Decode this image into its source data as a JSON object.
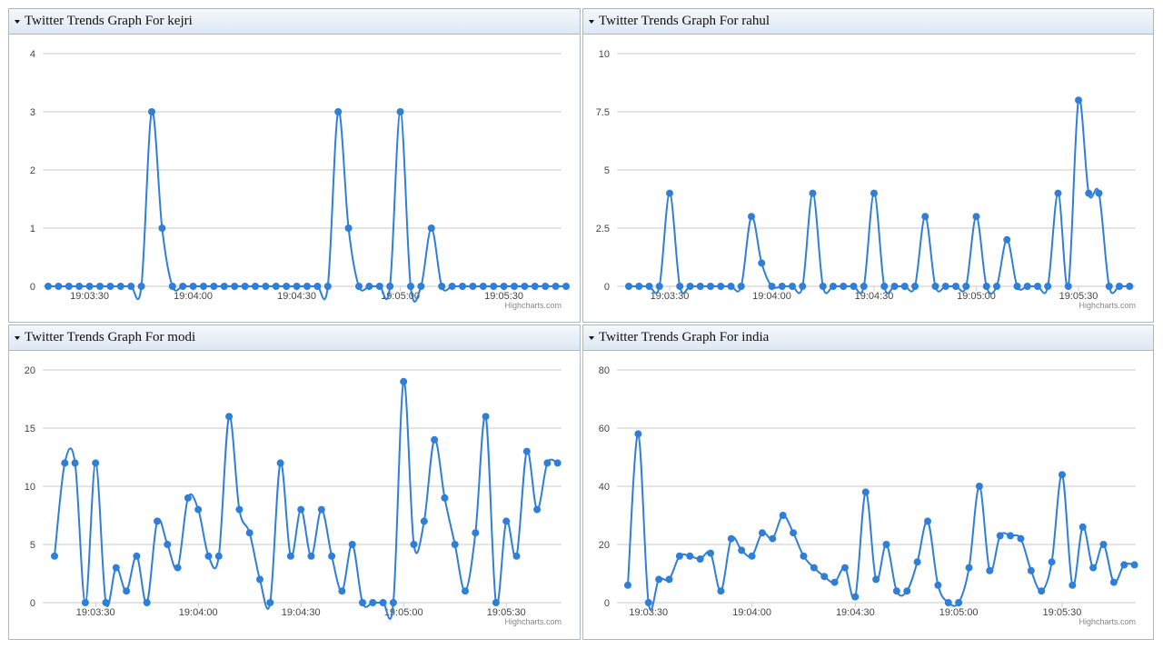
{
  "panels": [
    {
      "title": "Twitter Trends Graph For kejri"
    },
    {
      "title": "Twitter Trends Graph For rahul"
    },
    {
      "title": "Twitter Trends Graph For modi"
    },
    {
      "title": "Twitter Trends Graph For india"
    }
  ],
  "credit": "Highcharts.com",
  "accent_color": "#2f7ed8",
  "chart_data": [
    {
      "type": "line",
      "title": "Twitter Trends Graph For kejri",
      "x_tick_labels": [
        "19:03:30",
        "19:04:00",
        "19:04:30",
        "19:05:00",
        "19:05:30"
      ],
      "y_ticks": [
        "0",
        "1",
        "2",
        "3",
        "4"
      ],
      "ylim": [
        0,
        4
      ],
      "grid": true,
      "series": [
        {
          "values": [
            0,
            0,
            0,
            0,
            0,
            0,
            0,
            0,
            0,
            0,
            3,
            1,
            0,
            0,
            0,
            0,
            0,
            0,
            0,
            0,
            0,
            0,
            0,
            0,
            0,
            0,
            0,
            0,
            3,
            1,
            0,
            0,
            0,
            0,
            3,
            0,
            0,
            1,
            0,
            0,
            0,
            0,
            0,
            0,
            0,
            0,
            0,
            0,
            0,
            0,
            0
          ]
        }
      ]
    },
    {
      "type": "line",
      "title": "Twitter Trends Graph For rahul",
      "x_tick_labels": [
        "19:03:30",
        "19:04:00",
        "19:04:30",
        "19:05:00",
        "19:05:30"
      ],
      "y_ticks": [
        "0",
        "2.5",
        "5",
        "7.5",
        "10"
      ],
      "ylim": [
        0,
        10
      ],
      "grid": true,
      "series": [
        {
          "values": [
            0,
            0,
            0,
            0,
            4,
            0,
            0,
            0,
            0,
            0,
            0,
            0,
            3,
            1,
            0,
            0,
            0,
            0,
            4,
            0,
            0,
            0,
            0,
            0,
            4,
            0,
            0,
            0,
            0,
            3,
            0,
            0,
            0,
            0,
            3,
            0,
            0,
            2,
            0,
            0,
            0,
            0,
            4,
            0,
            8,
            4,
            4,
            0,
            0,
            0
          ]
        }
      ]
    },
    {
      "type": "line",
      "title": "Twitter Trends Graph For modi",
      "x_tick_labels": [
        "19:03:30",
        "19:04:00",
        "19:04:30",
        "19:05:00",
        "19:05:30"
      ],
      "y_ticks": [
        "0",
        "5",
        "10",
        "15",
        "20"
      ],
      "ylim": [
        0,
        20
      ],
      "grid": true,
      "series": [
        {
          "values": [
            4,
            12,
            12,
            0,
            12,
            0,
            3,
            1,
            4,
            0,
            7,
            5,
            3,
            9,
            8,
            4,
            4,
            16,
            8,
            6,
            2,
            0,
            12,
            4,
            8,
            4,
            8,
            4,
            1,
            5,
            0,
            0,
            0,
            0,
            19,
            5,
            7,
            14,
            9,
            5,
            1,
            6,
            16,
            0,
            7,
            4,
            13,
            8,
            12,
            12
          ]
        }
      ]
    },
    {
      "type": "line",
      "title": "Twitter Trends Graph For india",
      "x_tick_labels": [
        "19:03:30",
        "19:04:00",
        "19:04:30",
        "19:05:00",
        "19:05:30"
      ],
      "y_ticks": [
        "0",
        "20",
        "40",
        "60",
        "80"
      ],
      "ylim": [
        0,
        80
      ],
      "grid": true,
      "series": [
        {
          "values": [
            6,
            58,
            0,
            8,
            8,
            16,
            16,
            15,
            17,
            4,
            22,
            18,
            16,
            24,
            22,
            30,
            24,
            16,
            12,
            9,
            7,
            12,
            2,
            38,
            8,
            20,
            4,
            4,
            14,
            28,
            6,
            0,
            0,
            12,
            40,
            11,
            23,
            23,
            22,
            11,
            4,
            14,
            44,
            6,
            26,
            12,
            20,
            7,
            13,
            13
          ]
        }
      ]
    }
  ]
}
